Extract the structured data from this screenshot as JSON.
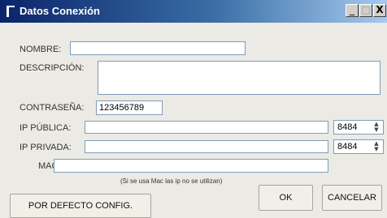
{
  "window": {
    "title": "Datos Conexión",
    "minimize": "_",
    "maximize": "□",
    "close": "X"
  },
  "form": {
    "nombre_label": "NOMBRE:",
    "nombre_value": "",
    "descripcion_label": "DESCRIPCIÓN:",
    "descripcion_value": "",
    "contrasena_label": "CONTRASEÑA:",
    "contrasena_value": "123456789",
    "ip_publica_label": "IP PÚBLICA:",
    "ip_publica_value": "",
    "ip_publica_port": "8484",
    "ip_privada_label": "IP PRIVADA:",
    "ip_privada_value": "",
    "ip_privada_port": "8484",
    "mac_label": "MAC:",
    "mac_value": "",
    "mac_hint": "(Si se usa Mac las ip no se utilizan)"
  },
  "buttons": {
    "defaults": "POR DEFECTO CONFIG.",
    "ok": "OK",
    "cancel": "CANCELAR"
  },
  "icons": {
    "app": "window-icon",
    "spin": "spinner-arrows-icon"
  }
}
